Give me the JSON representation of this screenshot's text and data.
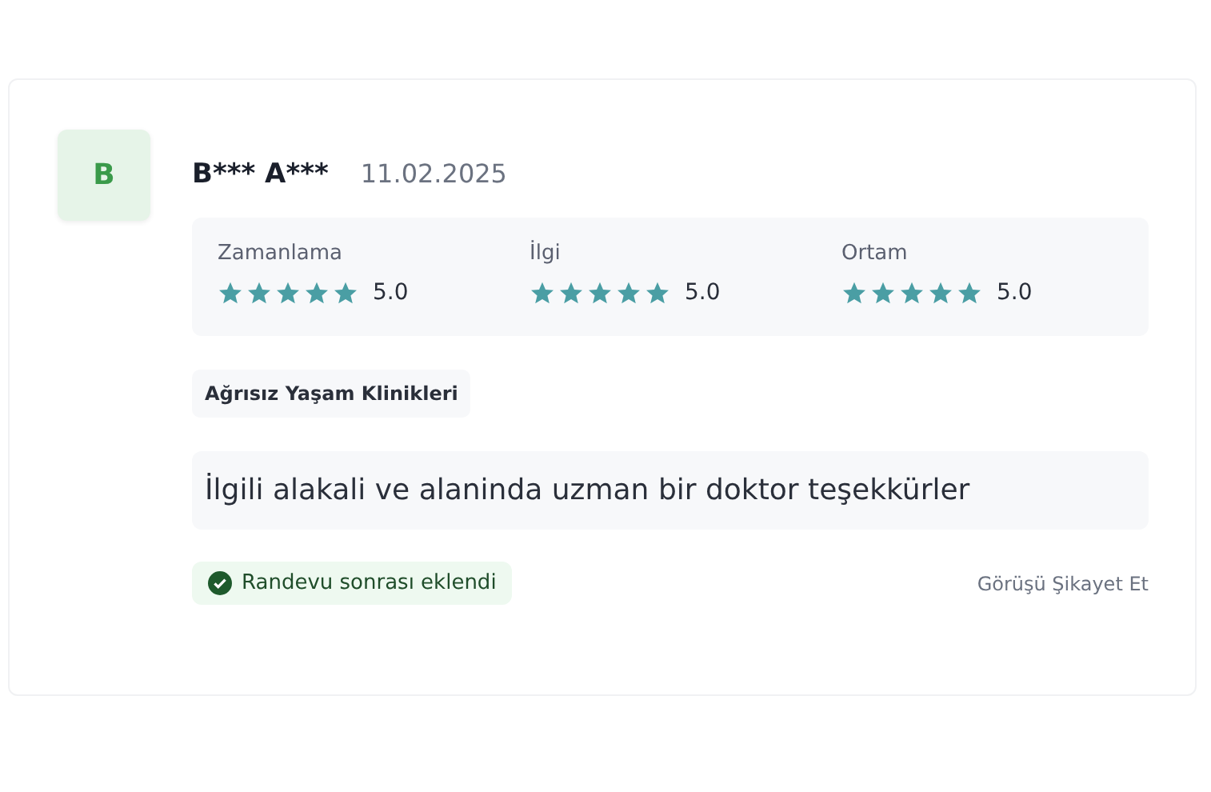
{
  "review": {
    "avatar": "B",
    "author": "B*** A***",
    "date": "11.02.2025",
    "ratings": [
      {
        "label": "Zamanlama",
        "stars": 5,
        "score": "5.0"
      },
      {
        "label": "İlgi",
        "stars": 5,
        "score": "5.0"
      },
      {
        "label": "Ortam",
        "stars": 5,
        "score": "5.0"
      }
    ],
    "clinic": "Ağrısız Yaşam Klinikleri",
    "comment": "İlgili alakali ve alaninda uzman bir doktor teşekkürler",
    "badge": {
      "label": "Randevu sonrası eklendi",
      "verified": true
    },
    "report_link": "Görüşü Şikayet Et"
  }
}
